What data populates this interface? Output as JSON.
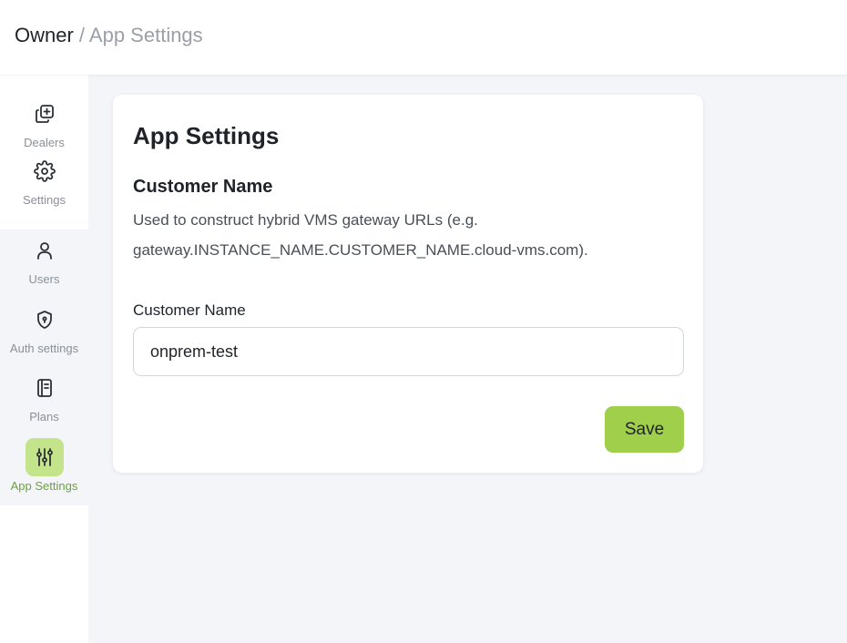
{
  "breadcrumb": {
    "root": "Owner",
    "separator": " / ",
    "current": "App Settings"
  },
  "sidebar": {
    "items": [
      {
        "label": "Dealers",
        "icon": "dealers-icon"
      },
      {
        "label": "Settings",
        "icon": "gear-icon"
      },
      {
        "label": "Users",
        "icon": "user-icon"
      },
      {
        "label": "Auth settings",
        "icon": "shield-icon"
      },
      {
        "label": "Plans",
        "icon": "notebook-icon"
      },
      {
        "label": "App Settings",
        "icon": "sliders-icon",
        "active": true
      }
    ]
  },
  "card": {
    "title": "App Settings",
    "section_title": "Customer Name",
    "description": "Used to construct hybrid VMS gateway URLs (e.g. gateway.INSTANCE_NAME.CUSTOMER_NAME.cloud-vms.com).",
    "field_label": "Customer Name",
    "field_value": "onprem-test",
    "save_label": "Save"
  },
  "colors": {
    "accent": "#a0cf4b",
    "accent_light": "#c4e48b",
    "active_text": "#6aa33a",
    "muted_text": "#8a9099",
    "background": "#f4f5f9"
  }
}
